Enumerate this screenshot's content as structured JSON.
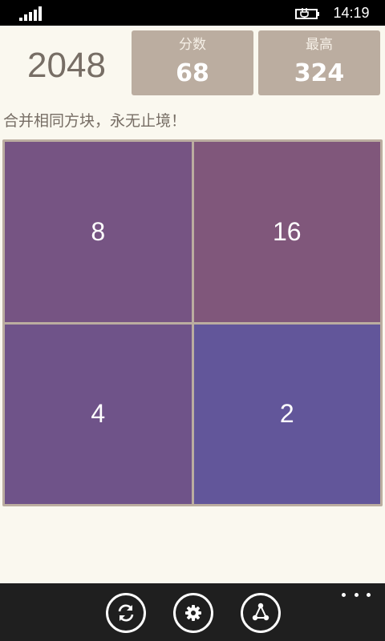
{
  "status_bar": {
    "time": "14:19",
    "signal_icon": "signal-bars-icon",
    "battery_icon": "battery-charging-icon"
  },
  "header": {
    "title": "2048",
    "score": {
      "label": "分数",
      "value": "68"
    },
    "best": {
      "label": "最高",
      "value": "324"
    }
  },
  "subtitle": "合并相同方块，永无止境！",
  "board": {
    "size": 2,
    "tiles": [
      {
        "row": 0,
        "col": 0,
        "value": "8",
        "color": "#765483"
      },
      {
        "row": 0,
        "col": 1,
        "value": "16",
        "color": "#80577b"
      },
      {
        "row": 1,
        "col": 0,
        "value": "4",
        "color": "#6f5389"
      },
      {
        "row": 1,
        "col": 1,
        "value": "2",
        "color": "#62569a"
      }
    ],
    "grid_color": "#bbada0"
  },
  "app_bar": {
    "buttons": [
      {
        "name": "refresh-button",
        "icon": "refresh-icon"
      },
      {
        "name": "settings-button",
        "icon": "gear-icon"
      },
      {
        "name": "share-button",
        "icon": "share-icon"
      }
    ],
    "more_icon": "more-dots-icon"
  }
}
